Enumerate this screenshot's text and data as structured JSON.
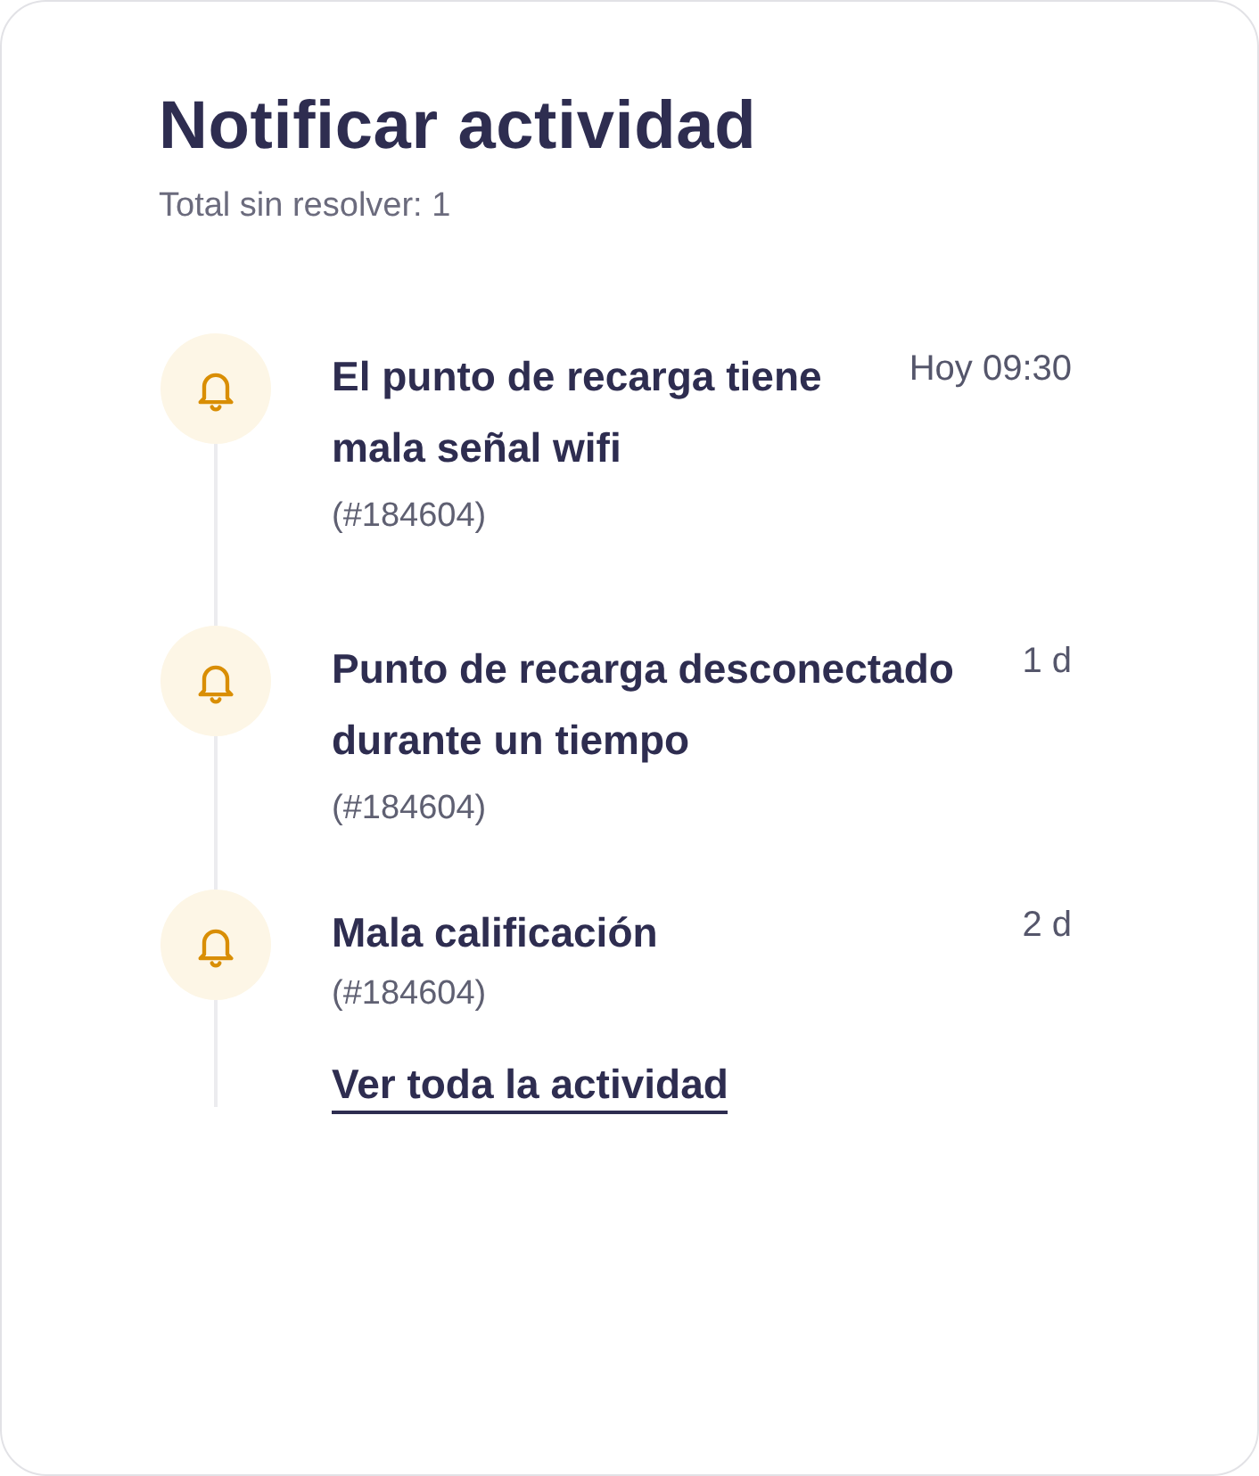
{
  "card": {
    "title": "Notificar actividad",
    "subtitle": "Total sin resolver: 1"
  },
  "notifications": [
    {
      "title": "El punto de recarga tiene mala señal wifi",
      "reference": "(#184604)",
      "time": "Hoy 09:30"
    },
    {
      "title": "Punto de recarga desconectado durante un tiempo",
      "reference": "(#184604)",
      "time": "1 d"
    },
    {
      "title": "Mala calificación",
      "reference": "(#184604)",
      "time": "2 d"
    }
  ],
  "link": "Ver toda la actividad"
}
